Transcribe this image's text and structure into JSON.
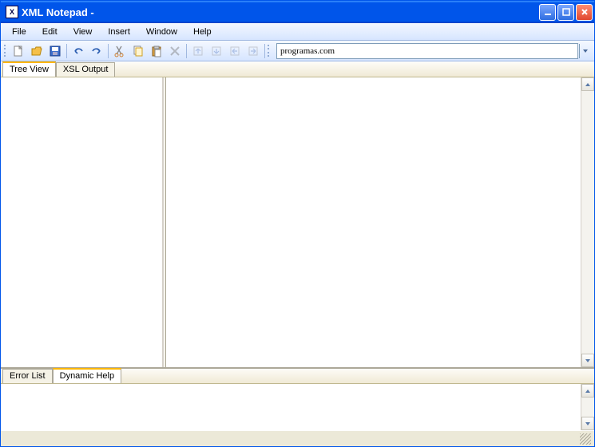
{
  "window": {
    "title": "XML Notepad -"
  },
  "menu": {
    "file": "File",
    "edit": "Edit",
    "view": "View",
    "insert": "Insert",
    "window": "Window",
    "help": "Help"
  },
  "toolbar": {
    "address_value": "programas.com"
  },
  "tabs_top": {
    "tree_view": "Tree View",
    "xsl_output": "XSL Output"
  },
  "tabs_bottom": {
    "error_list": "Error List",
    "dynamic_help": "Dynamic Help"
  }
}
